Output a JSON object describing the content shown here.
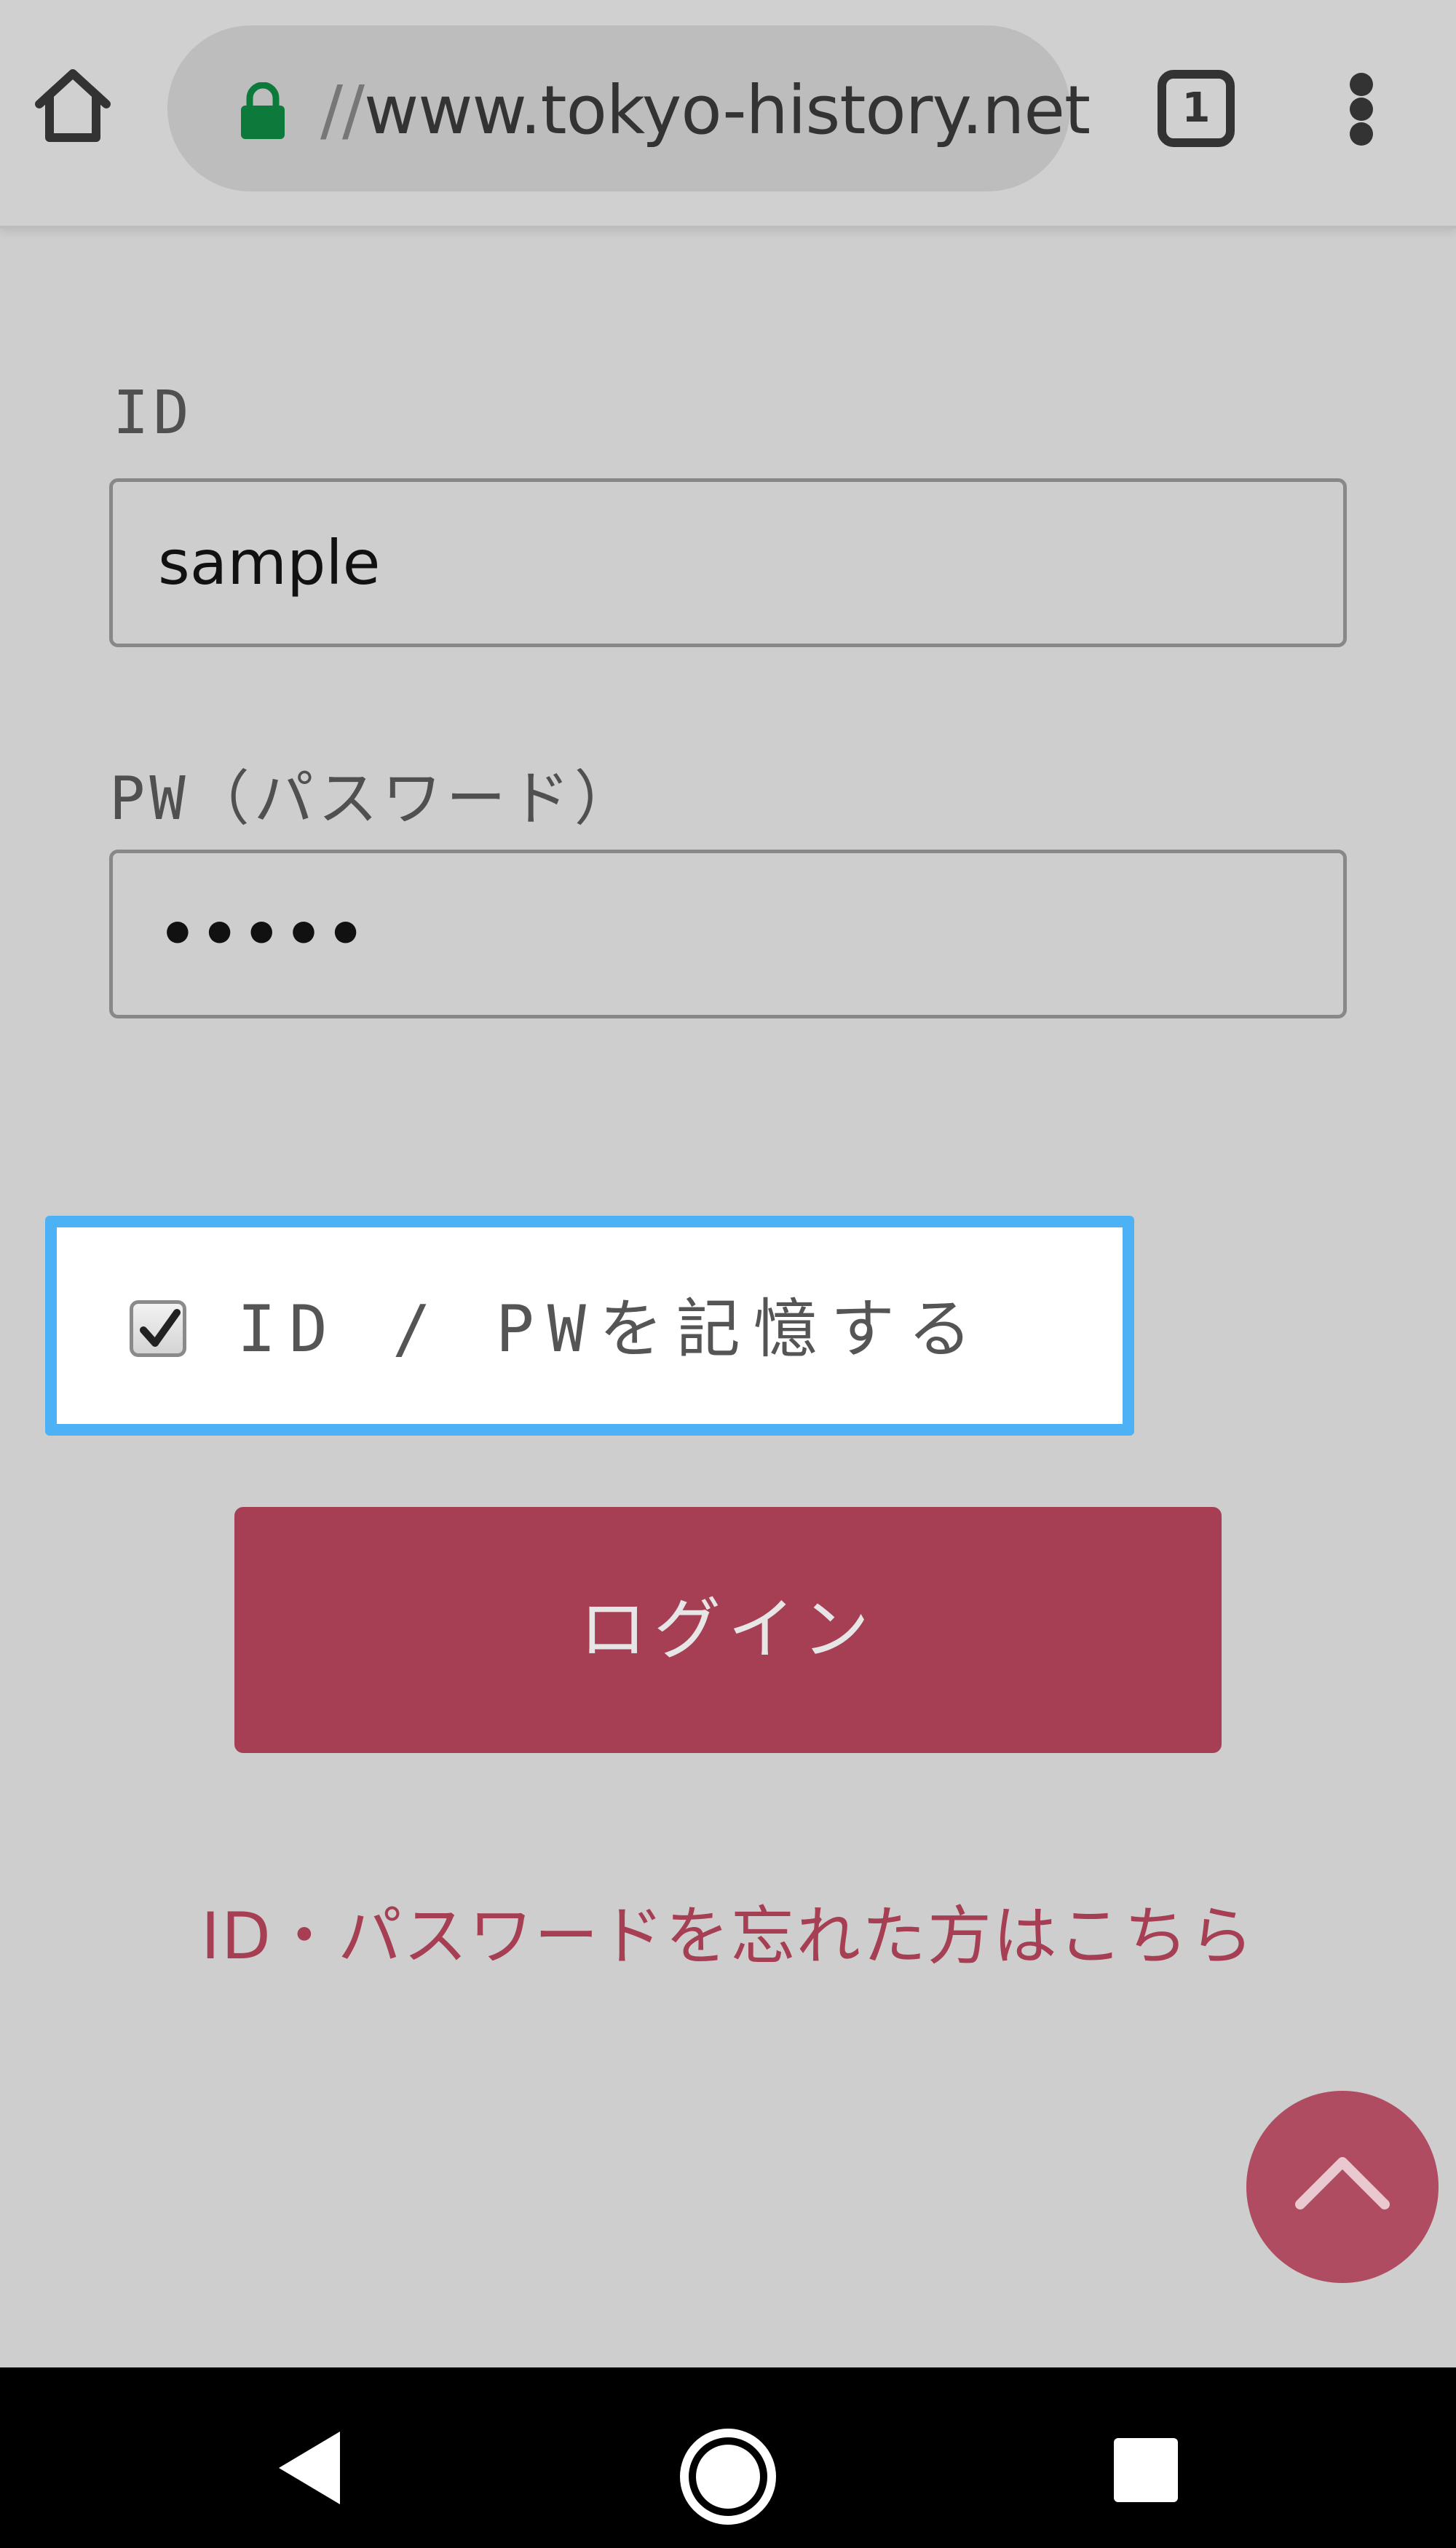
{
  "browser": {
    "url_scheme": "//",
    "url_host": "www.tokyo-history.net",
    "tab_count": "1",
    "icons": [
      "home-icon",
      "lock-icon",
      "tabs-icon",
      "more-vert-icon"
    ],
    "lock_color": "#0b7a3a"
  },
  "form": {
    "id_label": "ID",
    "id_value": "sample",
    "pw_label": "PW（パスワード）",
    "pw_value": "•••••",
    "remember_label": "ID / PWを記憶する",
    "remember_checked": true,
    "login_label": "ログイン",
    "forgot_link": "ID・パスワードを忘れた方はこちら"
  },
  "colors": {
    "accent": "#a63f53",
    "focus_ring": "#4db2f5",
    "page_bg": "#cecece"
  },
  "scroll_top": {
    "icon": "chevron-up-icon"
  },
  "android_nav": {
    "icons": [
      "back-icon",
      "home-circle-icon",
      "recents-icon"
    ]
  }
}
